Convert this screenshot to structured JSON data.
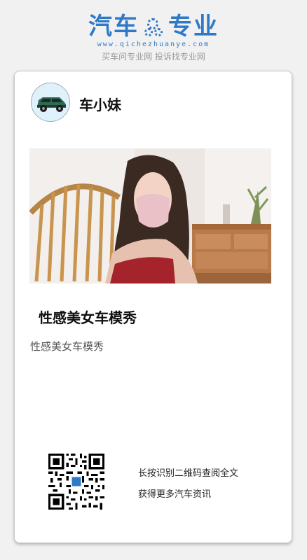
{
  "header": {
    "logo_left": "汽车",
    "logo_right": "专业",
    "domain": "www.qichezhuanye.com",
    "slogan": "买车问专业网 投诉找专业网",
    "brand_color": "#2f7ac8"
  },
  "post": {
    "author_name": "车小妹",
    "avatar_icon": "car-icon",
    "cover_image": "model-photo",
    "title": "性感美女车模秀",
    "summary": "性感美女车模秀"
  },
  "qr": {
    "icon": "qr-code-icon",
    "line1": "长按识别二维码查阅全文",
    "line2": "获得更多汽车资讯"
  }
}
